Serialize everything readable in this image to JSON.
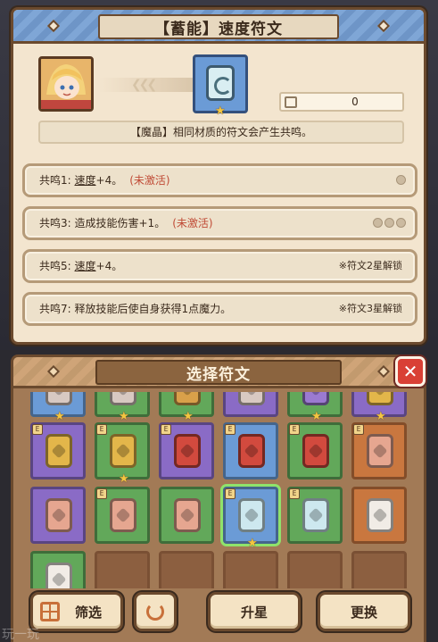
{
  "detail": {
    "title": "【蓄能】速度符文",
    "rune_count": "0",
    "resonance_description": "【魔晶】相同材质的符文会产生共鸣。",
    "effects": [
      {
        "prefix": "共鸣1: ",
        "keyword": "速度",
        "rest": "+4。",
        "status": "(未激活)",
        "right": "",
        "dots": 1
      },
      {
        "prefix": "共鸣3: ",
        "keyword": "",
        "rest": "造成技能伤害+1。",
        "status": "(未激活)",
        "right": "",
        "dots": 3
      },
      {
        "prefix": "共鸣5: ",
        "keyword": "速度",
        "rest": "+4。",
        "status": "",
        "right": "※符文2星解锁",
        "dots": 0
      },
      {
        "prefix": "共鸣7: ",
        "keyword": "",
        "rest": "释放技能后使自身获得1点魔力。",
        "status": "",
        "right": "※符文3星解锁",
        "dots": 0
      }
    ]
  },
  "selection": {
    "title": "选择符文",
    "close_label": "✕"
  },
  "rune_grid": [
    {
      "row": 0,
      "col": 0,
      "frame": "#6b9bd6",
      "core": "#d8c9c2",
      "badge": "",
      "star": true
    },
    {
      "row": 0,
      "col": 1,
      "frame": "#62a85a",
      "core": "#d8c9c2",
      "badge": "",
      "star": true
    },
    {
      "row": 0,
      "col": 2,
      "frame": "#62a85a",
      "core": "#d9a04a",
      "badge": "",
      "star": true
    },
    {
      "row": 0,
      "col": 3,
      "frame": "#8a6bc6",
      "core": "#d8c9c2",
      "badge": "",
      "star": false
    },
    {
      "row": 0,
      "col": 4,
      "frame": "#62a85a",
      "core": "#9b7ad1",
      "badge": "",
      "star": true
    },
    {
      "row": 0,
      "col": 5,
      "frame": "#8a6bc6",
      "core": "#e3b64a",
      "badge": "",
      "star": true
    },
    {
      "row": 1,
      "col": 0,
      "frame": "#8a6bc6",
      "core": "#e3b64a",
      "badge": "E",
      "star": false
    },
    {
      "row": 1,
      "col": 1,
      "frame": "#62a85a",
      "core": "#e3b64a",
      "badge": "E",
      "star": true
    },
    {
      "row": 1,
      "col": 2,
      "frame": "#8a6bc6",
      "core": "#d24a3e",
      "badge": "E",
      "star": false
    },
    {
      "row": 1,
      "col": 3,
      "frame": "#6b9bd6",
      "core": "#d24a3e",
      "badge": "E",
      "star": false
    },
    {
      "row": 1,
      "col": 4,
      "frame": "#62a85a",
      "core": "#d24a3e",
      "badge": "E",
      "star": false
    },
    {
      "row": 1,
      "col": 5,
      "frame": "#c9773f",
      "core": "#e6a690",
      "badge": "E",
      "star": false
    },
    {
      "row": 2,
      "col": 0,
      "frame": "#8a6bc6",
      "core": "#e6a690",
      "badge": "",
      "star": false
    },
    {
      "row": 2,
      "col": 1,
      "frame": "#62a85a",
      "core": "#e6a690",
      "badge": "E",
      "star": false
    },
    {
      "row": 2,
      "col": 2,
      "frame": "#62a85a",
      "core": "#e6a690",
      "badge": "",
      "star": false
    },
    {
      "row": 2,
      "col": 3,
      "frame": "#6b9bd6",
      "core": "#cde8ef",
      "badge": "E",
      "star": true,
      "selected": true
    },
    {
      "row": 2,
      "col": 4,
      "frame": "#62a85a",
      "core": "#cde8ef",
      "badge": "E",
      "star": false
    },
    {
      "row": 2,
      "col": 5,
      "frame": "#c9773f",
      "core": "#f1ece6",
      "badge": "",
      "star": false
    },
    {
      "row": 3,
      "col": 0,
      "frame": "#62a85a",
      "core": "#f1ece6",
      "badge": "",
      "star": false
    },
    {
      "row": 3,
      "col": 1,
      "empty": true
    },
    {
      "row": 3,
      "col": 2,
      "empty": true
    },
    {
      "row": 3,
      "col": 3,
      "empty": true
    },
    {
      "row": 3,
      "col": 4,
      "empty": true
    },
    {
      "row": 3,
      "col": 5,
      "empty": true
    }
  ],
  "buttons": {
    "filter": "筛选",
    "upgrade": "升星",
    "swap": "更换"
  },
  "watermark": "玩一玩",
  "colors": {
    "frame_blue": "#6b9bd6",
    "frame_green": "#62a85a",
    "frame_purple": "#8a6bc6",
    "frame_orange": "#c9773f",
    "inactive_red": "#c04b36",
    "close_red": "#d94035"
  }
}
